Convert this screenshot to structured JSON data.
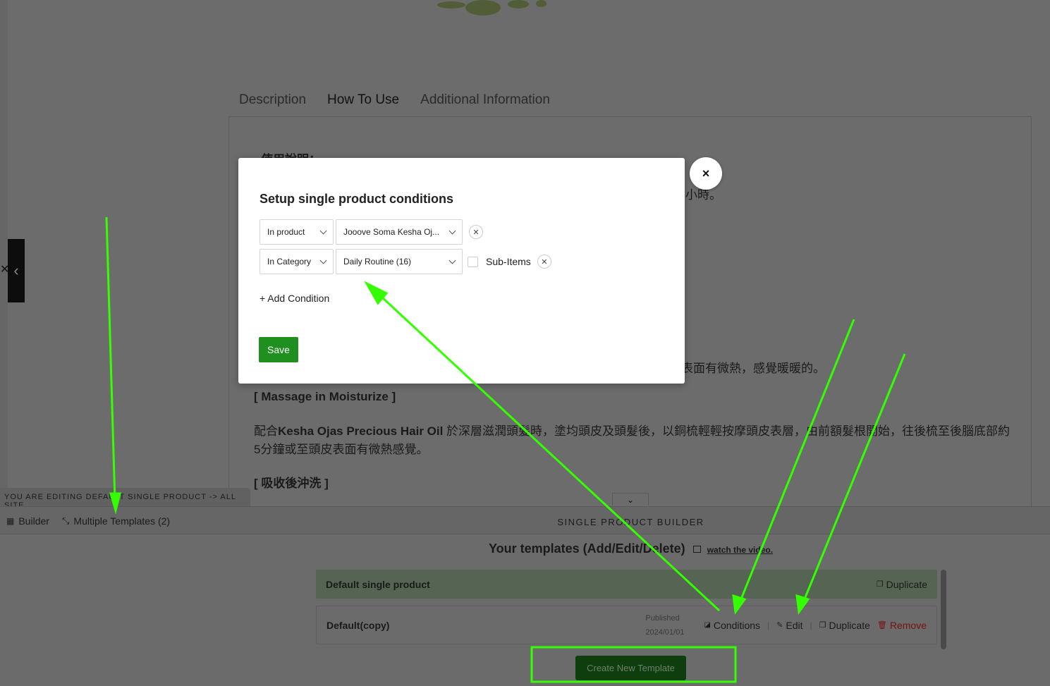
{
  "background": {
    "product_tabs": [
      {
        "label": "Description",
        "active": false
      },
      {
        "label": "How To Use",
        "active": true
      },
      {
        "label": "Additional Information",
        "active": false
      }
    ],
    "usage_heading": "使用說明：",
    "partial_line_1": "小時。",
    "partial_line_2": "表面有微熱，感覺暖暖的。",
    "massage_heading": "[ Massage in Moisturize ]",
    "massage_text_prefix": "配合",
    "massage_text_bold": "Kesha Ojas Precious Hair Oil",
    "massage_text_rest": " 於深層滋潤頭髮時，塗均頭皮及頭髮後，以銅梳輕輕按摩頭皮表層，由前額髮根開始，往後梳至後腦底部約5分鐘或至頭皮表面有微熱感覺。",
    "rinse_heading": "[ 吸收後沖洗 ]"
  },
  "editor_bar": {
    "banner": "YOU ARE EDITING DEFAULT SINGLE PRODUCT -> ALL SITE",
    "builder_label": "Builder",
    "multiple_templates_label": "Multiple Templates (2)",
    "title": "SINGLE PRODUCT BUILDER"
  },
  "templates_panel": {
    "heading": "Your templates (Add/Edit/Delete)",
    "watch_video": "watch the video.",
    "templates": [
      {
        "name": "Default single product",
        "is_default": true,
        "actions": [
          "Duplicate"
        ]
      },
      {
        "name": "Default(copy)",
        "status": "Published",
        "date": "2024/01/01",
        "actions": [
          "Conditions",
          "Edit",
          "Duplicate",
          "Remove"
        ]
      }
    ],
    "create_button": "Create New Template"
  },
  "modal": {
    "title": "Setup single product conditions",
    "conditions": [
      {
        "type": "In product",
        "value": "Jooove Soma Kesha Oj...",
        "has_sub_items": false
      },
      {
        "type": "In Category",
        "value": "Daily Routine (16)",
        "has_sub_items": true,
        "sub_items_label": "Sub-Items",
        "sub_items_checked": false
      }
    ],
    "add_condition": "+ Add Condition",
    "save": "Save",
    "close": "×"
  },
  "colors": {
    "annotation": "#33ff00",
    "save_green": "#1f8f1f",
    "remove_red": "#7a1010"
  }
}
